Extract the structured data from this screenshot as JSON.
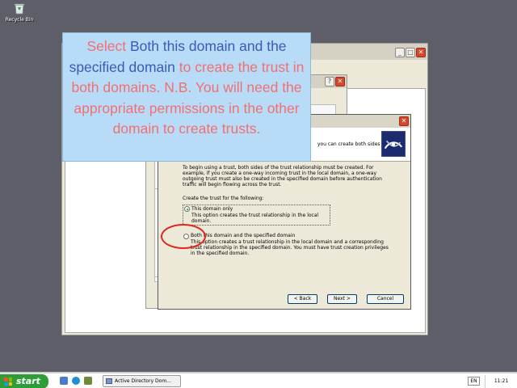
{
  "desktop": {
    "recycle_bin_label": "Recycle Bin"
  },
  "titlebar_buttons": {
    "minimize": "_",
    "maximize": "□",
    "help": "?",
    "close": "✕"
  },
  "wizard": {
    "header_text": "you can create both sides of",
    "intro": "To begin using a trust, both sides of the trust relationship must be created. For example, if you create a one-way incoming trust in the local domain, a one-way outgoing trust must also be created in the specified domain before authentication traffic will begin flowing across the trust.",
    "create_label": "Create the trust for the following:",
    "options": [
      {
        "label": "This domain only",
        "description": "This option creates the trust relationship in the local domain.",
        "selected": true
      },
      {
        "label": "Both this domain and the specified domain",
        "description": "This option creates a trust relationship in the local domain and a corresponding trust relationship in the specified domain. You must have trust creation privileges in the specified domain.",
        "selected": false
      }
    ],
    "back_button": "< Back",
    "next_button": "Next >",
    "cancel_button": "Cancel"
  },
  "callout": {
    "part1": "Select ",
    "part2": "Both this domain and the specified domain",
    "part3": " to create the trust in both domains. N.B. You will need the appropriate permissions in the other domain to create trusts."
  },
  "taskbar": {
    "start_label": "start",
    "task_label": "Active Directory Dom...",
    "language": "EN",
    "clock": "11:21"
  },
  "colors": {
    "callout_blue_text": "#3a5bb4",
    "callout_red_text": "#f07070",
    "callout_background": "#b8dcf8",
    "highlight_circle": "#e2261c",
    "start_button": "#2d9d38",
    "desktop": "#5e5e68"
  }
}
